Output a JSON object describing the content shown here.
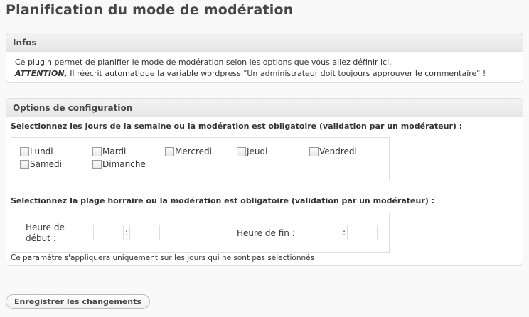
{
  "page": {
    "title": "Planification du mode de modération"
  },
  "infos": {
    "header": "Infos",
    "line1": "Ce plugin permet de planifier le mode de modération selon les options que vous allez définir ici.",
    "attention": "ATTENTION,",
    "line2": " Il réécrit automatique la variable wordpress \"Un administrateur doit toujours approuver le commentaire\" !"
  },
  "config": {
    "header": "Options de configuration",
    "days_label": "Selectionnez les jours de la semaine ou la modération est obligatoire (validation par un modérateur) :",
    "days": [
      {
        "label": "Lundi",
        "checked": false
      },
      {
        "label": "Mardi",
        "checked": false
      },
      {
        "label": "Mercredi",
        "checked": false
      },
      {
        "label": "Jeudi",
        "checked": false
      },
      {
        "label": "Vendredi",
        "checked": false
      },
      {
        "label": "Samedi",
        "checked": false
      },
      {
        "label": "Dimanche",
        "checked": false
      }
    ],
    "time_label": "Selectionnez la plage horraire ou la modération est obligatoire (validation par un modérateur) :",
    "start_label_1": "Heure de",
    "start_label_2": "début :",
    "end_label": "Heure de fin :",
    "separator": ":",
    "start_hour": "",
    "start_minute": "",
    "end_hour": "",
    "end_minute": "",
    "note": "Ce paramètre s'appliquera uniquement sur les jours qui ne sont pas sélectionnés"
  },
  "actions": {
    "save_label": "Enregistrer les changements"
  }
}
